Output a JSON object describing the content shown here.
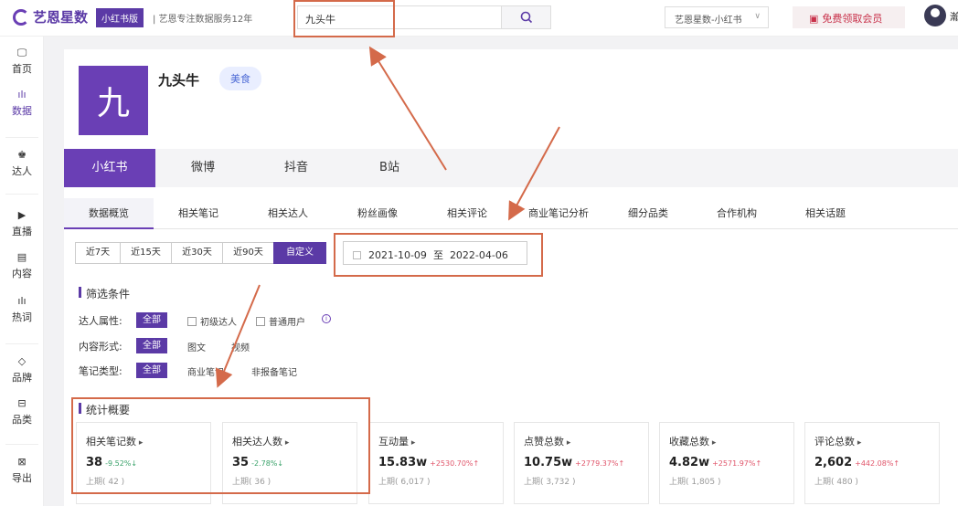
{
  "topbar": {
    "logo_text": "艺恩星数",
    "logo_tag": "小红书版",
    "slogan": "| 艺恩专注数据服务12年",
    "search_value": "九头牛",
    "app_select": "艺恩星数-小红书",
    "vip_label": "免费领取会员",
    "user_name": "瀚"
  },
  "sidebar": {
    "items": [
      {
        "label": "首页",
        "icon": "monitor-icon"
      },
      {
        "label": "数据",
        "icon": "bar-chart-icon"
      },
      {
        "label": "达人",
        "icon": "person-icon"
      },
      {
        "label": "直播",
        "icon": "play-icon"
      },
      {
        "label": "内容",
        "icon": "document-icon"
      },
      {
        "label": "热词",
        "icon": "bar-chart-icon"
      },
      {
        "label": "品牌",
        "icon": "diamond-icon"
      },
      {
        "label": "品类",
        "icon": "box-icon"
      },
      {
        "label": "导出",
        "icon": "excel-icon"
      }
    ]
  },
  "brand": {
    "logo_char": "九",
    "name": "九头牛",
    "tag": "美食"
  },
  "platform_tabs": [
    "小红书",
    "微博",
    "抖音",
    "B站"
  ],
  "sub_tabs": [
    "数据概览",
    "相关笔记",
    "相关达人",
    "粉丝画像",
    "相关评论",
    "商业笔记分析",
    "细分品类",
    "合作机构",
    "相关话题"
  ],
  "range_buttons": [
    "近7天",
    "近15天",
    "近30天",
    "近90天",
    "自定义"
  ],
  "date_range": {
    "start": "2021-10-09",
    "sep": "至",
    "end": "2022-04-06"
  },
  "filters": {
    "title": "筛选条件",
    "rows": [
      {
        "label": "达人属性:",
        "all": "全部",
        "options": [
          "初级达人",
          "普通用户"
        ]
      },
      {
        "label": "内容形式:",
        "all": "全部",
        "options": [
          "图文",
          "视频"
        ]
      },
      {
        "label": "笔记类型:",
        "all": "全部",
        "options": [
          "商业笔记",
          "非报备笔记"
        ]
      }
    ]
  },
  "stats": {
    "title": "统计概要",
    "cards": [
      {
        "title": "相关笔记数",
        "value": "38",
        "change": "-9.52%↓",
        "dir": "down",
        "prev": "上期( 42 )"
      },
      {
        "title": "相关达人数",
        "value": "35",
        "change": "-2.78%↓",
        "dir": "down",
        "prev": "上期( 36 )"
      },
      {
        "title": "互动量",
        "value": "15.83w",
        "change": "+2530.70%↑",
        "dir": "up",
        "prev": "上期( 6,017 )"
      },
      {
        "title": "点赞总数",
        "value": "10.75w",
        "change": "+2779.37%↑",
        "dir": "up",
        "prev": "上期( 3,732 )"
      },
      {
        "title": "收藏总数",
        "value": "4.82w",
        "change": "+2571.97%↑",
        "dir": "up",
        "prev": "上期( 1,805 )"
      },
      {
        "title": "评论总数",
        "value": "2,602",
        "change": "+442.08%↑",
        "dir": "up",
        "prev": "上期( 480 )"
      }
    ]
  },
  "colors": {
    "accent": "#5b3aa6",
    "annotation": "#d46a4a",
    "up": "#e0556a",
    "down": "#3aa26a"
  }
}
